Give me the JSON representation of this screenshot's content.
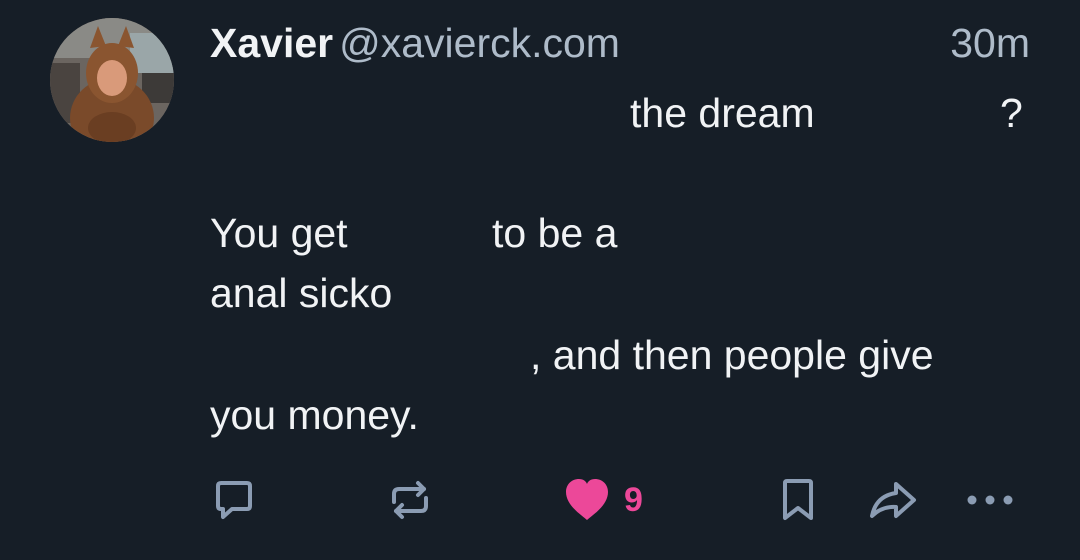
{
  "post": {
    "author": {
      "display_name": "Xavier",
      "handle": "@xavierck.com",
      "avatar_description": "person in brown costume"
    },
    "timestamp": "30m",
    "text": {
      "line1_a": "the dream",
      "line1_b": "?",
      "line2_a": "You get",
      "line2_b": "to be a",
      "line3": "anal sicko",
      "line4": ", and then people give",
      "line5": "you money."
    },
    "actions": {
      "reply_icon": "reply-icon",
      "repost_icon": "repost-icon",
      "like_icon": "heart-icon",
      "like_count": "9",
      "bookmark_icon": "bookmark-icon",
      "share_icon": "share-icon",
      "more_icon": "more-icon"
    },
    "colors": {
      "background": "#161e27",
      "text": "#f1f3f5",
      "muted": "#aebbc9",
      "icon": "#8b9cb3",
      "like": "#ec4899"
    }
  }
}
